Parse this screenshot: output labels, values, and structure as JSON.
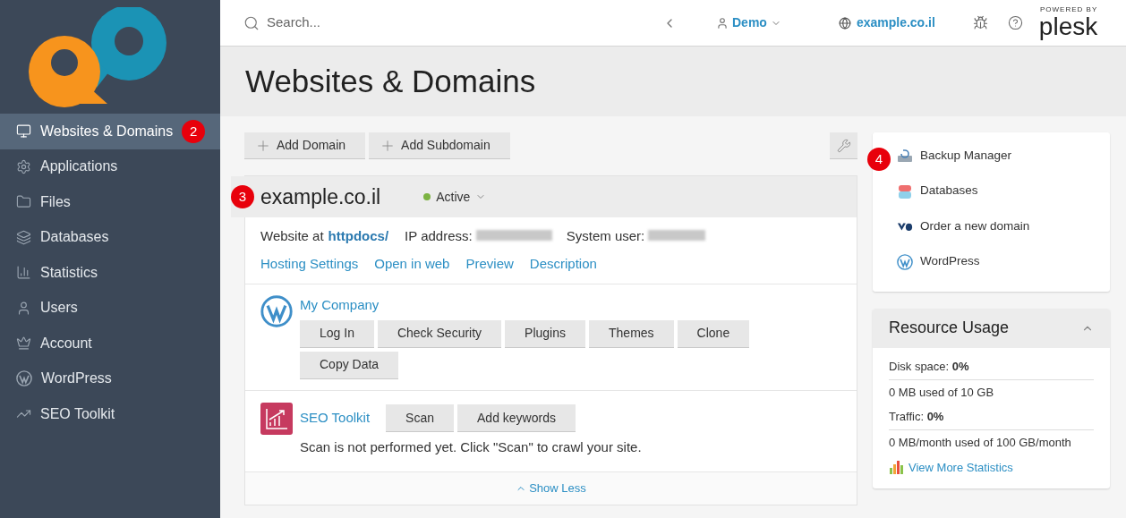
{
  "sidebar": {
    "items": [
      {
        "label": "Websites & Domains",
        "selected": true,
        "badge": "2"
      },
      {
        "label": "Applications",
        "selected": false
      },
      {
        "label": "Files",
        "selected": false
      },
      {
        "label": "Databases",
        "selected": false
      },
      {
        "label": "Statistics",
        "selected": false
      },
      {
        "label": "Users",
        "selected": false
      },
      {
        "label": "Account",
        "selected": false
      },
      {
        "label": "WordPress",
        "selected": false
      },
      {
        "label": "SEO Toolkit",
        "selected": false
      }
    ]
  },
  "header": {
    "search": {
      "placeholder": "Search..."
    },
    "user": "Demo",
    "domain": "example.co.il",
    "brand_top": "POWERED BY",
    "brand": "plesk"
  },
  "page": {
    "title": "Websites & Domains"
  },
  "toolbar": {
    "buttons": [
      "Add Domain",
      "Add Subdomain"
    ]
  },
  "domain": {
    "badge": "3",
    "name": "example.co.il",
    "status": {
      "label": "Active",
      "color": "#7cb342"
    },
    "website_prefix": "Website at",
    "website_link": "httpdocs/",
    "ip_label": "IP address:",
    "user_label": "System user:",
    "links": [
      "Hosting Settings",
      "Open in web",
      "Preview",
      "Description"
    ],
    "wordpress": {
      "name": "My Company",
      "buttons": [
        "Log In",
        "Check Security",
        "Plugins",
        "Themes",
        "Clone",
        "Copy Data"
      ]
    },
    "seo": {
      "name": "SEO Toolkit",
      "buttons": [
        "Scan",
        "Add keywords"
      ],
      "message": "Scan is not performed yet. Click \"Scan\" to crawl your site."
    },
    "toggle": "Show Less"
  },
  "side_links": {
    "badge": "4",
    "items": [
      {
        "label": "Backup Manager"
      },
      {
        "label": "Databases"
      },
      {
        "label": "Order a new domain"
      },
      {
        "label": "WordPress"
      }
    ]
  },
  "resource_usage": {
    "title": "Resource Usage",
    "expanded": true,
    "rows": [
      "Disk space: **0%**",
      "0 MB used of 10 GB",
      "Traffic: **0%**",
      "0 MB/month used of 100 GB/month"
    ],
    "link": "View More Statistics"
  }
}
